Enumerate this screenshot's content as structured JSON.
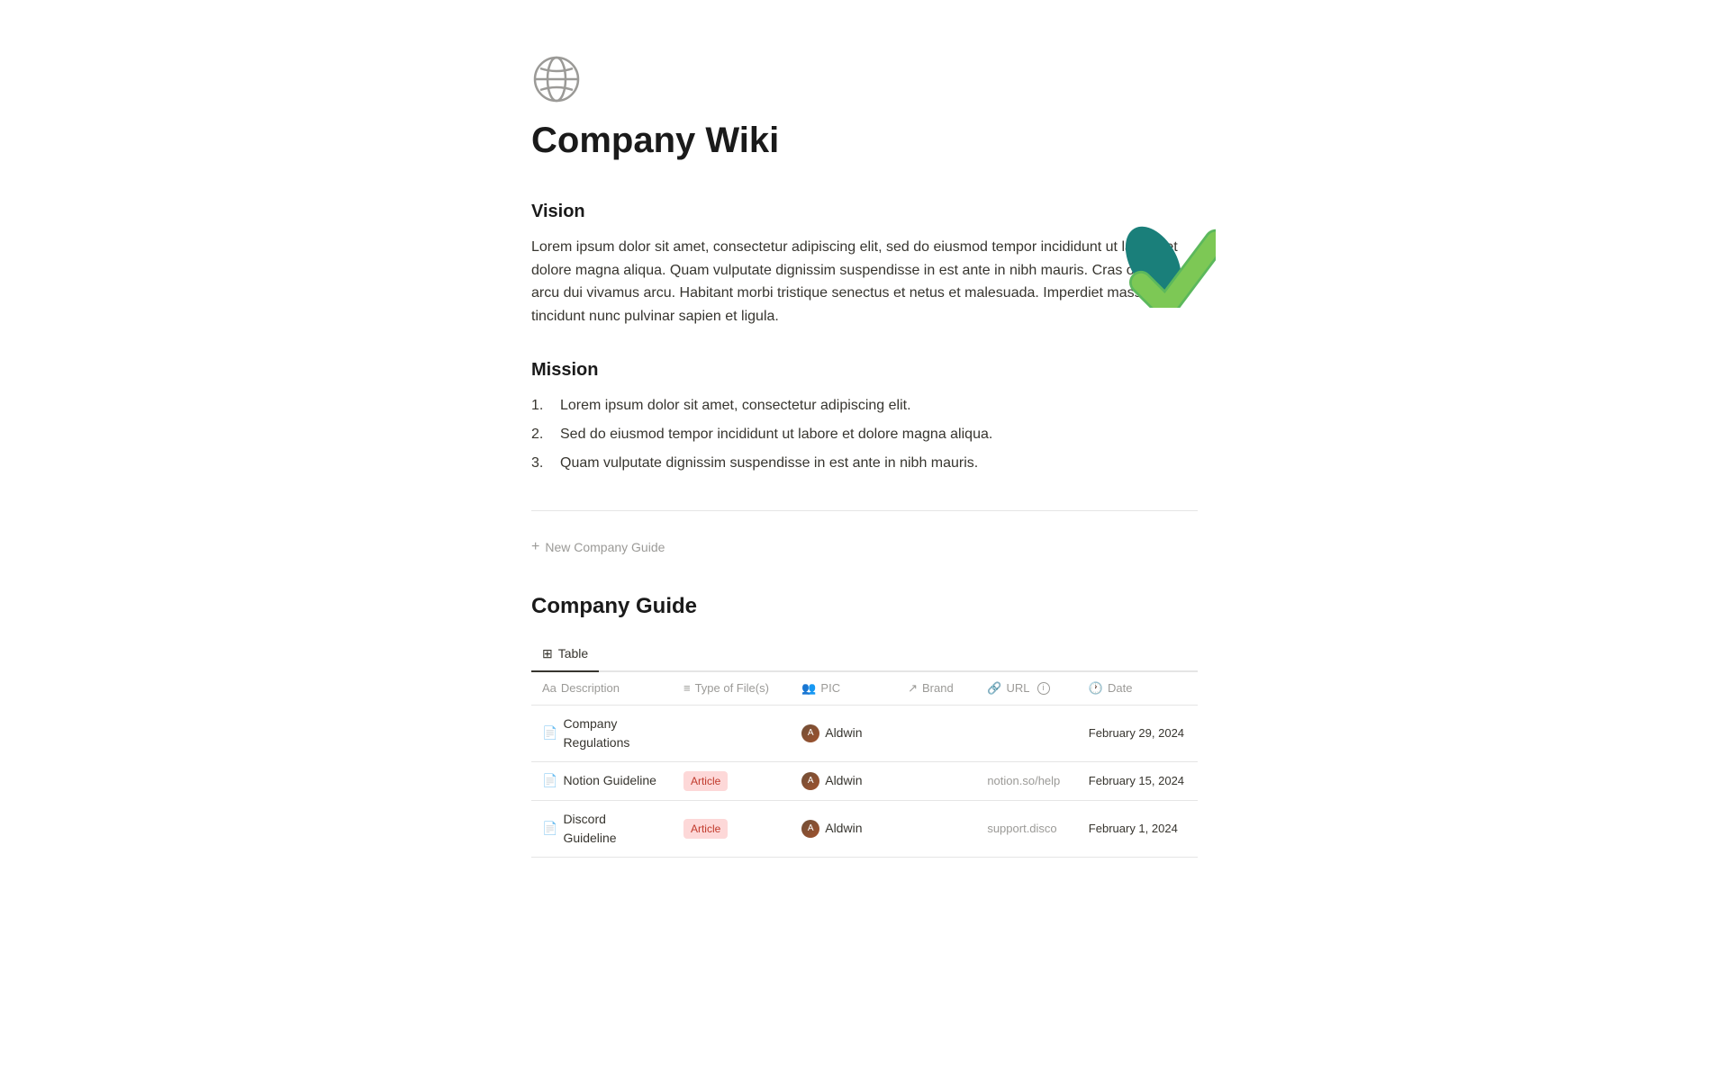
{
  "page": {
    "icon": "🌐",
    "title": "Company Wiki"
  },
  "vision": {
    "heading": "Vision",
    "body": "Lorem ipsum dolor sit amet, consectetur adipiscing elit, sed do eiusmod tempor incididunt ut labore et dolore magna aliqua. Quam vulputate dignissim suspendisse in est ante in nibh mauris. Cras ornare arcu dui vivamus arcu. Habitant morbi tristique senectus et netus et malesuada. Imperdiet massa tincidunt nunc pulvinar sapien et ligula."
  },
  "mission": {
    "heading": "Mission",
    "items": [
      "Lorem ipsum dolor sit amet, consectetur adipiscing elit.",
      "Sed do eiusmod tempor incididunt ut labore et dolore magna aliqua.",
      "Quam vulputate dignissim suspendisse in est ante in nibh mauris."
    ]
  },
  "add_new": {
    "label": "New Company Guide"
  },
  "company_guide": {
    "section_title": "Company Guide",
    "tabs": [
      {
        "label": "Table",
        "active": true
      }
    ],
    "table": {
      "columns": [
        {
          "icon": "Aa",
          "label": "Description"
        },
        {
          "icon": "≡",
          "label": "Type of File(s)"
        },
        {
          "icon": "👥",
          "label": "PIC"
        },
        {
          "icon": "↗",
          "label": "Brand"
        },
        {
          "icon": "🔗",
          "label": "URL",
          "info": true
        },
        {
          "icon": "🕐",
          "label": "Date"
        }
      ],
      "rows": [
        {
          "description": "Company Regulations",
          "type": "",
          "pic": "Aldwin",
          "brand": "",
          "url": "",
          "date": "February 29, 2024"
        },
        {
          "description": "Notion Guideline",
          "type": "Article",
          "pic": "Aldwin",
          "brand": "",
          "url": "notion.so/help",
          "date": "February 15, 2024"
        },
        {
          "description": "Discord Guideline",
          "type": "Article",
          "pic": "Aldwin",
          "brand": "",
          "url": "support.disco",
          "date": "February 1, 2024"
        }
      ]
    }
  }
}
